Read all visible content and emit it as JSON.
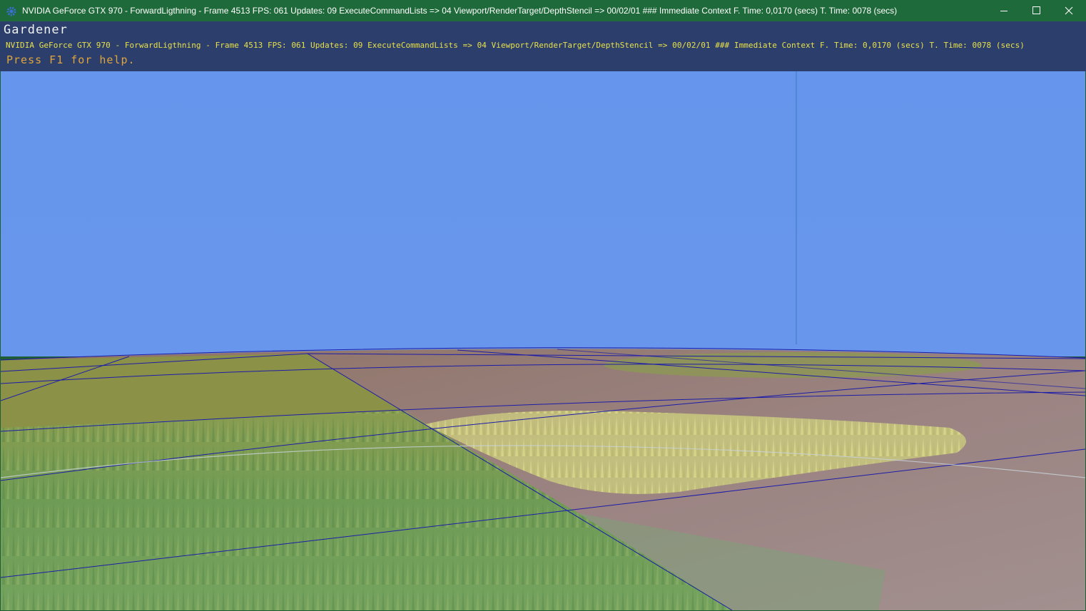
{
  "window": {
    "title": "NVIDIA GeForce GTX 970 - ForwardLigthning - Frame 4513 FPS: 061 Updates: 09 ExecuteCommandLists => 04 Viewport/RenderTarget/DepthStencil => 00/02/01 ### Immediate Context F. Time: 0,0170 (secs) T. Time: 0078 (secs)",
    "icon": "gear-icon",
    "buttons": {
      "minimize": "minimize-icon",
      "maximize": "maximize-icon",
      "close": "close-icon"
    }
  },
  "hud": {
    "title": "Gardener",
    "stats": "NVIDIA GeForce GTX 970 - ForwardLigthning - Frame 4513 FPS: 061 Updates: 09 ExecuteCommandLists => 04 Viewport/RenderTarget/DepthStencil => 00/02/01 ### Immediate Context F. Time: 0,0170 (secs) T. Time: 0078 (secs)",
    "help": "Press F1 for help."
  },
  "colors": {
    "titlebar": "#1f6a3a",
    "hud_background": "#2c3f6c",
    "hud_title": "#f1f1f1",
    "hud_stats": "#e8e04a",
    "hud_help": "#e0a43a",
    "sky": "#6495ed",
    "grass_far": "#8a9a4a",
    "grass_near": "#6f9a5a",
    "dirt": "#8c7268",
    "grid_lines": "#1a1aa0"
  }
}
